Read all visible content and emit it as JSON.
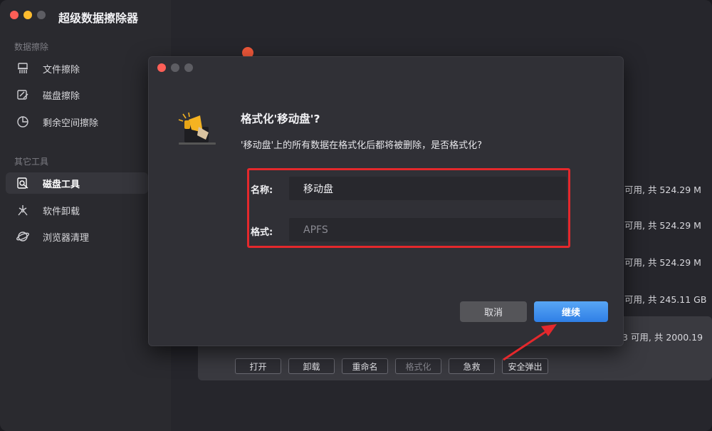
{
  "app": {
    "title": "超级数据擦除器"
  },
  "sidebar": {
    "section1": "数据擦除",
    "section2": "其它工具",
    "items": [
      {
        "label": "文件擦除",
        "icon": "shredder-icon"
      },
      {
        "label": "磁盘擦除",
        "icon": "disk-edit-icon"
      },
      {
        "label": "剩余空间擦除",
        "icon": "pie-chart-icon"
      },
      {
        "label": "磁盘工具",
        "icon": "disk-tool-icon",
        "active": true
      },
      {
        "label": "软件卸载",
        "icon": "uninstall-icon"
      },
      {
        "label": "浏览器清理",
        "icon": "globe-icon"
      }
    ]
  },
  "main": {
    "drives": [
      "可用, 共 524.29 M",
      "可用, 共 524.29 M",
      "可用, 共 524.29 M",
      "可用, 共 245.11 GB",
      "3 可用, 共 2000.19"
    ],
    "actions": [
      "打开",
      "卸载",
      "重命名",
      "格式化",
      "急救",
      "安全弹出"
    ]
  },
  "dialog": {
    "title": "格式化'移动盘'?",
    "message": "'移动盘'上的所有数据在格式化后都将被删除，是否格式化?",
    "name_label": "名称:",
    "name_value": "移动盘",
    "format_label": "格式:",
    "format_value": "APFS",
    "cancel": "取消",
    "continue": "继续"
  },
  "colors": {
    "accent": "#2f7fe6",
    "highlight": "#e4282c"
  }
}
